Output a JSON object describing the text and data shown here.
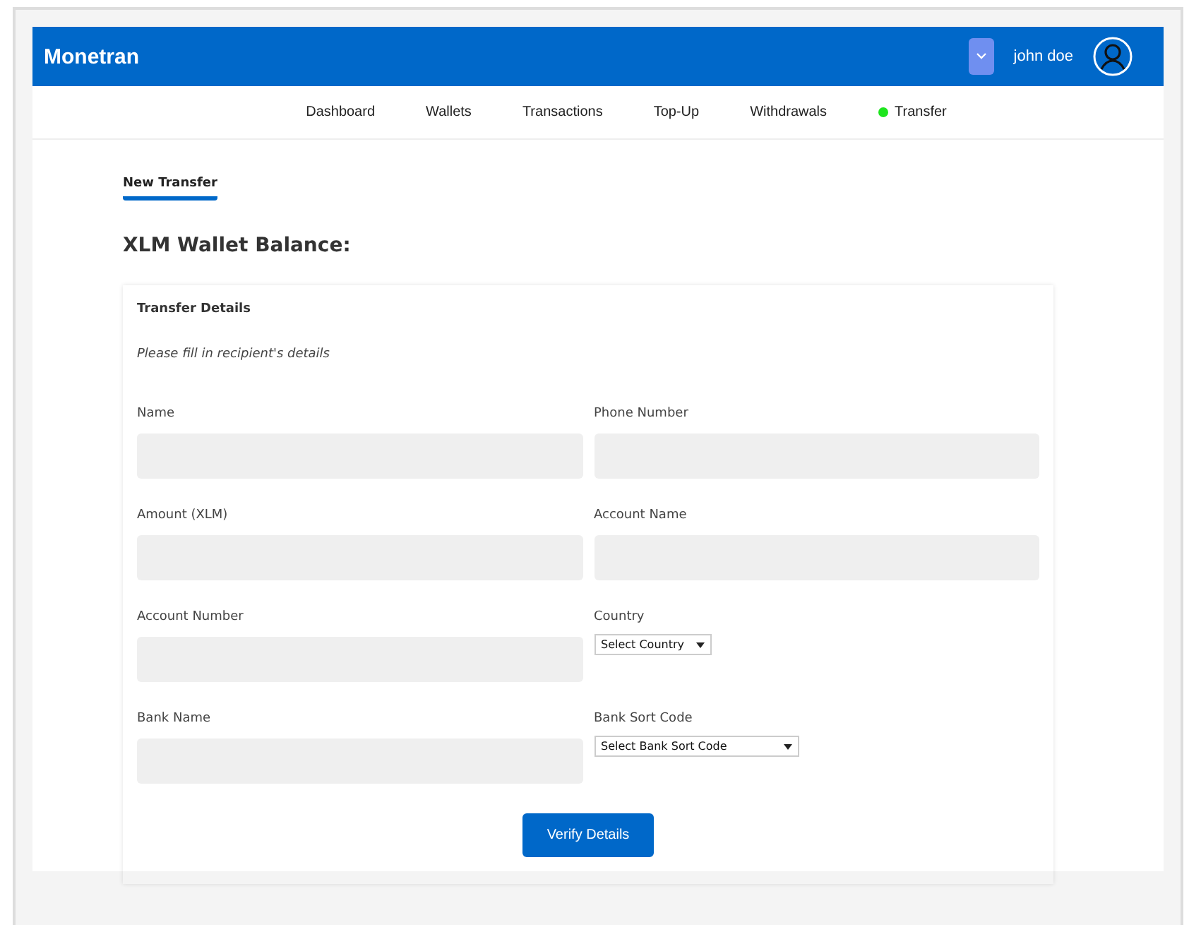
{
  "header": {
    "logo": "Monetran",
    "user": "john doe"
  },
  "nav": [
    {
      "label": "Dashboard",
      "selected": false
    },
    {
      "label": "Wallets",
      "selected": false
    },
    {
      "label": "Transactions",
      "selected": false
    },
    {
      "label": "Top-Up",
      "selected": false
    },
    {
      "label": "Withdrawals",
      "selected": false
    },
    {
      "label": "Transfer",
      "selected": true
    }
  ],
  "tabs": [
    {
      "label": "New Transfer",
      "selected": true
    }
  ],
  "balance_heading": "XLM Wallet Balance:",
  "card": {
    "title": "Transfer Details",
    "hint": "Please fill in recipient's details",
    "fields": [
      {
        "label": "Name",
        "kind": "input"
      },
      {
        "label": "Phone Number",
        "kind": "input"
      },
      {
        "label": "Amount (XLM)",
        "kind": "input"
      },
      {
        "label": "Account Name",
        "kind": "input"
      },
      {
        "label": "Account Number",
        "kind": "input"
      },
      {
        "label": "Country",
        "kind": "select",
        "value": "Select Country"
      },
      {
        "label": "Bank Name",
        "kind": "input"
      },
      {
        "label": "Bank Sort Code",
        "kind": "select",
        "value": "Select Bank Sort Code"
      }
    ],
    "button": "Verify Details"
  }
}
